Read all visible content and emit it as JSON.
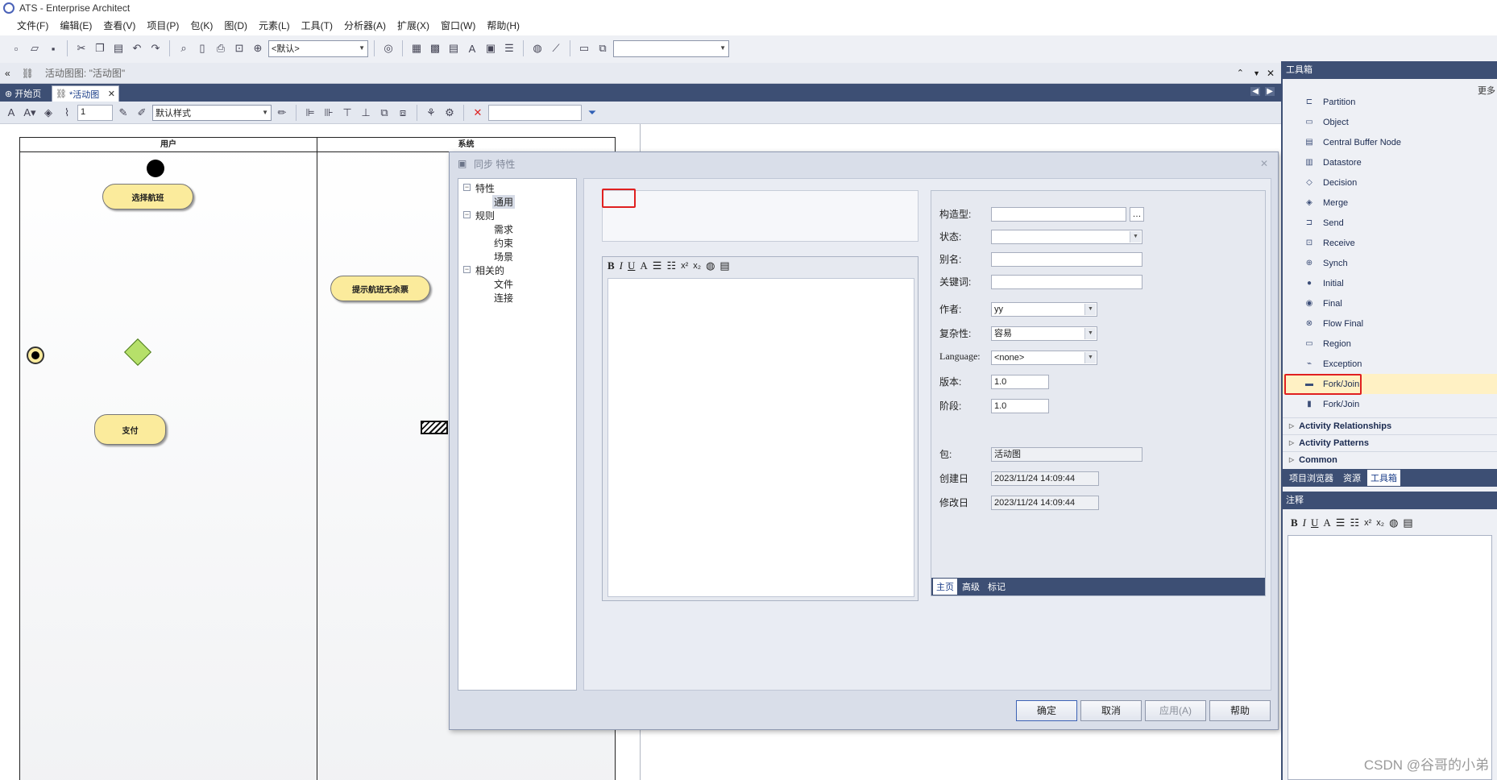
{
  "window": {
    "title": "ATS - Enterprise Architect"
  },
  "menu": [
    "文件(F)",
    "编辑(E)",
    "查看(V)",
    "项目(P)",
    "包(K)",
    "图(D)",
    "元素(L)",
    "工具(T)",
    "分析器(A)",
    "扩展(X)",
    "窗口(W)",
    "帮助(H)"
  ],
  "toolbar": {
    "style_combo": "<默认>",
    "search_combo": ""
  },
  "diagram": {
    "header": "活动图图: \"活动图\"",
    "tabs": [
      "开始页",
      "*活动图"
    ],
    "format_style": "默认样式",
    "line_width": "1",
    "pools": [
      {
        "name": "用户"
      },
      {
        "name": "系统"
      }
    ],
    "actions": [
      "选择航班",
      "提示航班无余票",
      "支付"
    ]
  },
  "dialog": {
    "title": "同步 特性",
    "tree": {
      "properties": "特性",
      "general": "通用",
      "rules": "规则",
      "requirements": "需求",
      "constraints": "约束",
      "scenarios": "场景",
      "related": "相关的",
      "files": "文件",
      "links": "连接"
    },
    "fields": {
      "stereotype_label": "构造型:",
      "status_label": "状态:",
      "alias_label": "别名:",
      "keywords_label": "关键词:",
      "author_label": "作者:",
      "author": "yy",
      "complexity_label": "复杂性:",
      "complexity": "容易",
      "language_label": "Language:",
      "language": "<none>",
      "version_label": "版本:",
      "version": "1.0",
      "phase_label": "阶段:",
      "phase": "1.0",
      "package_label": "包:",
      "package": "活动图",
      "created_label": "创建日",
      "created": "2023/11/24 14:09:44",
      "modified_label": "修改日",
      "modified": "2023/11/24 14:09:44"
    },
    "bottom_tabs": [
      "主页",
      "高级",
      "标记"
    ],
    "buttons": {
      "ok": "确定",
      "cancel": "取消",
      "apply": "应用(A)",
      "help": "帮助"
    }
  },
  "toolbox": {
    "title": "工具箱",
    "more": "更多",
    "items": [
      "Partition",
      "Object",
      "Central Buffer Node",
      "Datastore",
      "Decision",
      "Merge",
      "Send",
      "Receive",
      "Synch",
      "Initial",
      "Final",
      "Flow Final",
      "Region",
      "Exception",
      "Fork/Join",
      "Fork/Join"
    ],
    "groups": [
      "Activity Relationships",
      "Activity Patterns",
      "Common"
    ],
    "selected": "Fork/Join"
  },
  "bottom_tabs": [
    "项目浏览器",
    "资源",
    "工具箱"
  ],
  "notes": {
    "title": "注释"
  },
  "watermark": "CSDN @谷哥的小弟"
}
